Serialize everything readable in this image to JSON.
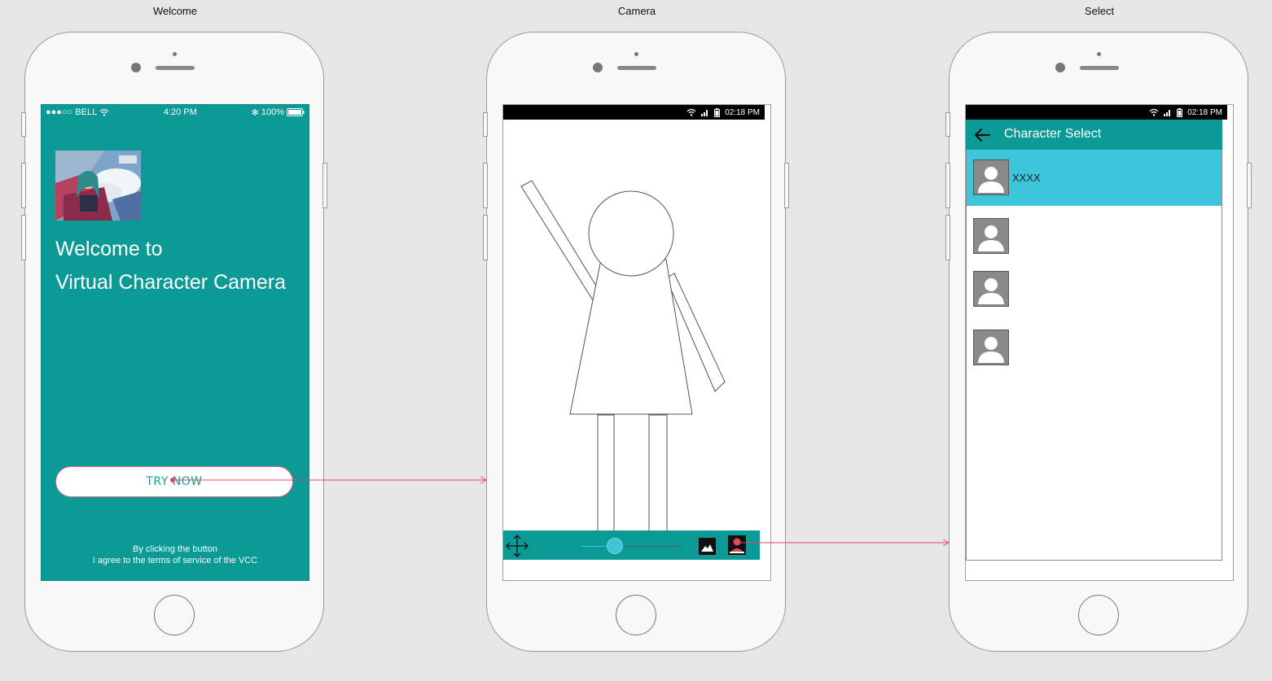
{
  "screens": [
    {
      "title": "Welcome"
    },
    {
      "title": "Camera"
    },
    {
      "title": "Select"
    }
  ],
  "welcome": {
    "status": {
      "carrier": "●●●○○ BELL",
      "time": "4:20 PM",
      "battery": "100%"
    },
    "cover_icon": "anime-cover-image",
    "heading_line1": "Welcome to",
    "heading_line2": "Virtual Character Camera",
    "try_button": "TRY NOW",
    "terms_line1": "By clicking the button",
    "terms_line2": "I agree to the terms of service of the VCC",
    "accent_color": "#0b9a96"
  },
  "camera": {
    "status_time": "02:18 PM",
    "toolbar": {
      "move_icon": "move-arrows-icon",
      "gallery_icon": "image-icon",
      "character_icon": "person-icon",
      "slider_level": 0.33
    }
  },
  "select": {
    "status_time": "02:18 PM",
    "title": "Character Select",
    "back_icon": "arrow-left-icon",
    "characters": [
      {
        "name": "XXXX",
        "selected": true
      },
      {
        "name": "",
        "selected": false
      },
      {
        "name": "",
        "selected": false
      },
      {
        "name": "",
        "selected": false
      }
    ],
    "selected_color": "#3cc5db"
  },
  "links_color": "#e8455f"
}
